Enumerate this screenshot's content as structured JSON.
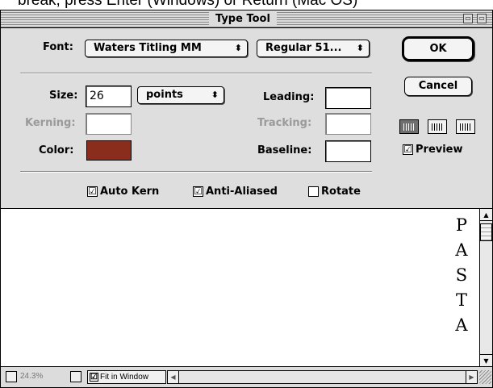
{
  "caption": "break, press Enter (Windows) or Return (Mac OS)",
  "window": {
    "title": "Type Tool"
  },
  "font": {
    "label": "Font:",
    "family": "Waters Titling MM",
    "style": "Regular 51..."
  },
  "size": {
    "label": "Size:",
    "value": "26",
    "unit": "points"
  },
  "leading": {
    "label": "Leading:",
    "value": ""
  },
  "kerning": {
    "label": "Kerning:",
    "value": ""
  },
  "tracking": {
    "label": "Tracking:",
    "value": ""
  },
  "color": {
    "label": "Color:",
    "swatch": "#8b2d1c"
  },
  "baseline": {
    "label": "Baseline:",
    "value": ""
  },
  "buttons": {
    "ok": "OK",
    "cancel": "Cancel"
  },
  "preview": {
    "label": "Preview",
    "checked": true
  },
  "options": {
    "auto_kern": {
      "label": "Auto Kern",
      "checked": true
    },
    "anti_aliased": {
      "label": "Anti-Aliased",
      "checked": true
    },
    "rotate": {
      "label": "Rotate",
      "checked": false
    }
  },
  "sample_letters": [
    "P",
    "A",
    "S",
    "T",
    "A"
  ],
  "status": {
    "zoom": "24.3%",
    "fit_label": "Fit in Window"
  },
  "glyphs": {
    "check": "☑",
    "arrows": "⬍",
    "up": "▲",
    "down": "▼",
    "left": "◀",
    "right": "▶"
  }
}
